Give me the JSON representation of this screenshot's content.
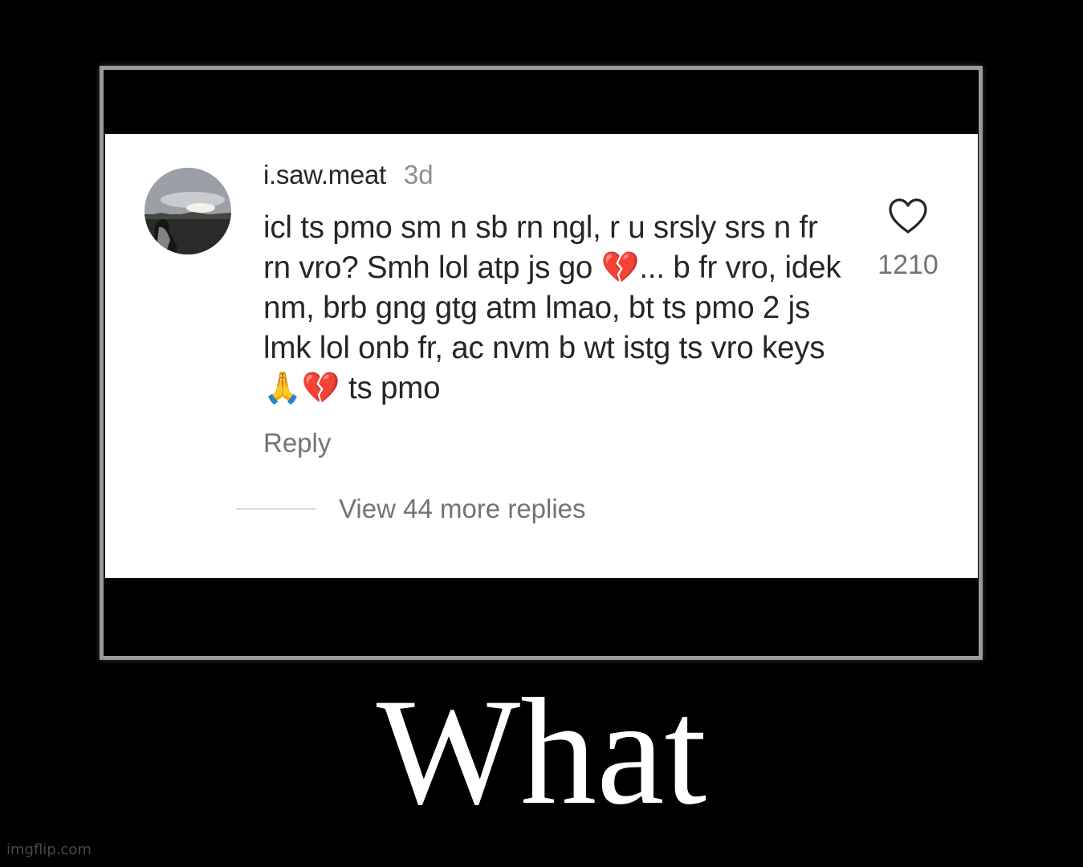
{
  "comment": {
    "username": "i.saw.meat",
    "time": "3d",
    "text": "icl ts pmo sm n sb rn ngl, r u srsly srs n fr rn vro? Smh lol atp js go 💔... b fr vro, idek nm, brb gng gtg atm lmao, bt ts pmo 2 js lmk lol onb fr, ac nvm b wt istg ts vro keys🙏💔 ts pmo",
    "reply_label": "Reply",
    "view_replies_label": "View 44 more replies",
    "like_count": "1210",
    "avatar_icon": "profile-photo-sunset-icon",
    "like_icon": "heart-outline-icon"
  },
  "poster": {
    "caption": "What"
  },
  "watermark": "imgflip.com",
  "colors": {
    "background": "#000000",
    "frame_border": "#9a9a9a",
    "card": "#ffffff",
    "primary_text": "#262626",
    "secondary_text": "#737373",
    "caption": "#ffffff"
  }
}
